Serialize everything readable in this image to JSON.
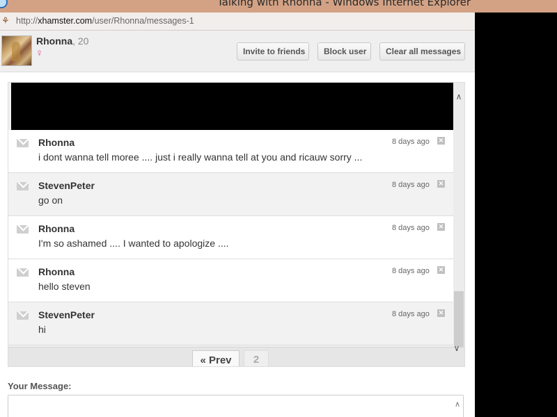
{
  "window": {
    "title": "Talking with Rhonna - Windows Internet Explorer",
    "browser_icon": "internet-explorer-icon"
  },
  "address_bar": {
    "url_prefix": "http://",
    "url_domain": "xhamster.com",
    "url_path": "/user/Rhonna/messages-1",
    "site_icon": "site-favicon-icon"
  },
  "profile": {
    "name": "Rhonna",
    "age": ", 20",
    "gender_icon": "♀"
  },
  "actions": {
    "invite": "Invite to friends",
    "block": "Block user",
    "clear": "Clear all messages"
  },
  "messages": [
    {
      "author": "Rhonna",
      "time": "8 days ago",
      "text": "i dont wanna tell moree .... just i really wanna tell at you and ricauw sorry ..."
    },
    {
      "author": "StevenPeter",
      "time": "8 days ago",
      "text": "go on"
    },
    {
      "author": "Rhonna",
      "time": "8 days ago",
      "text": "I'm so ashamed .... I wanted to apologize ...."
    },
    {
      "author": "Rhonna",
      "time": "8 days ago",
      "text": "hello steven"
    },
    {
      "author": "StevenPeter",
      "time": "8 days ago",
      "text": "hi"
    }
  ],
  "pager": {
    "prev": "« Prev",
    "current": "2"
  },
  "compose": {
    "label": "Your Message:",
    "value": ""
  },
  "colors": {
    "titlebar": "#d3a285",
    "gender": "#e0559a"
  }
}
